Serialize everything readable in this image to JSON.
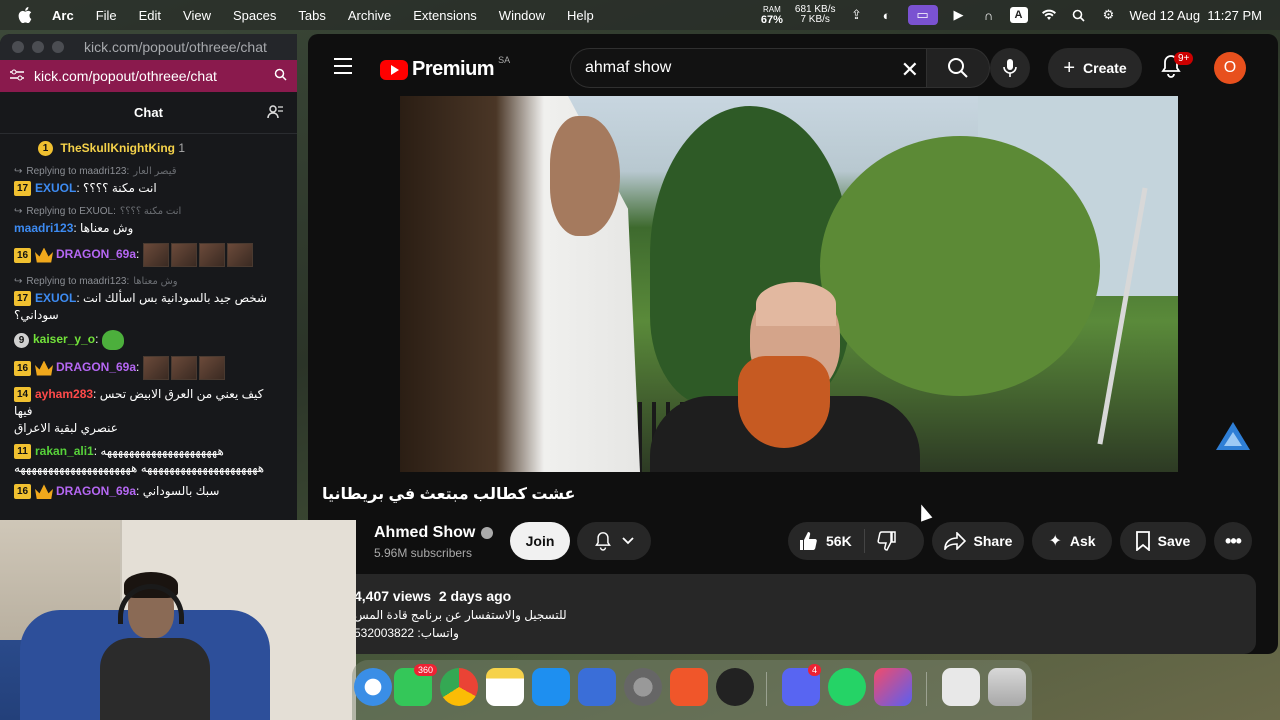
{
  "menubar": {
    "app": "Arc",
    "items": [
      "File",
      "Edit",
      "View",
      "Spaces",
      "Tabs",
      "Archive",
      "Extensions",
      "Window",
      "Help"
    ],
    "cpu_label": "RAM",
    "cpu_value": "67%",
    "net_up": "681 KB/s",
    "net_down": "7 KB/s",
    "input_letter": "A",
    "datetime": "Wed 12 Aug  11:27 PM"
  },
  "chat_window": {
    "title_url": "kick.com/popout/othreee/chat",
    "url": "kick.com/popout/othreee/chat",
    "header": "Chat",
    "messages": [
      {
        "badge": "1",
        "user": "TheSkullKnightKing",
        "suffix": "1"
      },
      {
        "reply_to": "Replying to maadri123:",
        "reply_quote": "قيصر العار",
        "badge": "17",
        "user": "EXUOL",
        "text": "انت مكنة ؟؟؟؟"
      },
      {
        "reply_to": "Replying to EXUOL:",
        "reply_quote": "انت مكنة ؟؟؟؟",
        "user": "maadri123",
        "text": "وش معناها"
      },
      {
        "badge": "16",
        "user": "DRAGON_69a",
        "text": ""
      },
      {
        "reply_to": "Replying to maadri123:",
        "reply_quote": "وش معناها",
        "badge": "17",
        "user": "EXUOL",
        "text": "شخص جيد بالسودانية بس اسألك انت سوداني؟"
      },
      {
        "badge": "9",
        "user": "kaiser_y_o",
        "text": ""
      },
      {
        "badge": "16",
        "user": "DRAGON_69a",
        "text": ""
      },
      {
        "badge": "14",
        "user": "ayham283",
        "text": "كيف يعني من العرق الابيض تحس فيها",
        "text2": "عنصري لبقية الاعراق"
      },
      {
        "badge": "11",
        "user": "rakan_ali1",
        "text": "هههههههههههههههههههههه",
        "text2": "هههههههههههههههههههههه هههههههههههههههههههههه"
      },
      {
        "badge": "16",
        "user": "DRAGON_69a",
        "text": "سبك بالسوداني"
      }
    ]
  },
  "youtube": {
    "brand": "Premium",
    "country": "SA",
    "search_value": "ahmaf show",
    "create_label": "Create",
    "notif_count": "9+",
    "avatar_letter": "O",
    "video_title": "عشت كطالب مبتعث في بريطانيا",
    "channel_name": "Ahmed Show",
    "subscribers": "5.96M subscribers",
    "join_label": "Join",
    "likes": "56K",
    "share_label": "Share",
    "ask_label": "Ask",
    "save_label": "Save",
    "desc_stats": "4,407 views  2 days ago",
    "desc_line1": "للتسجيل والاستفسار عن برنامج قادة المس",
    "desc_line2": "واتساب: 532003822"
  },
  "dock": {
    "messages_badge": "360",
    "discord_badge": "4"
  }
}
